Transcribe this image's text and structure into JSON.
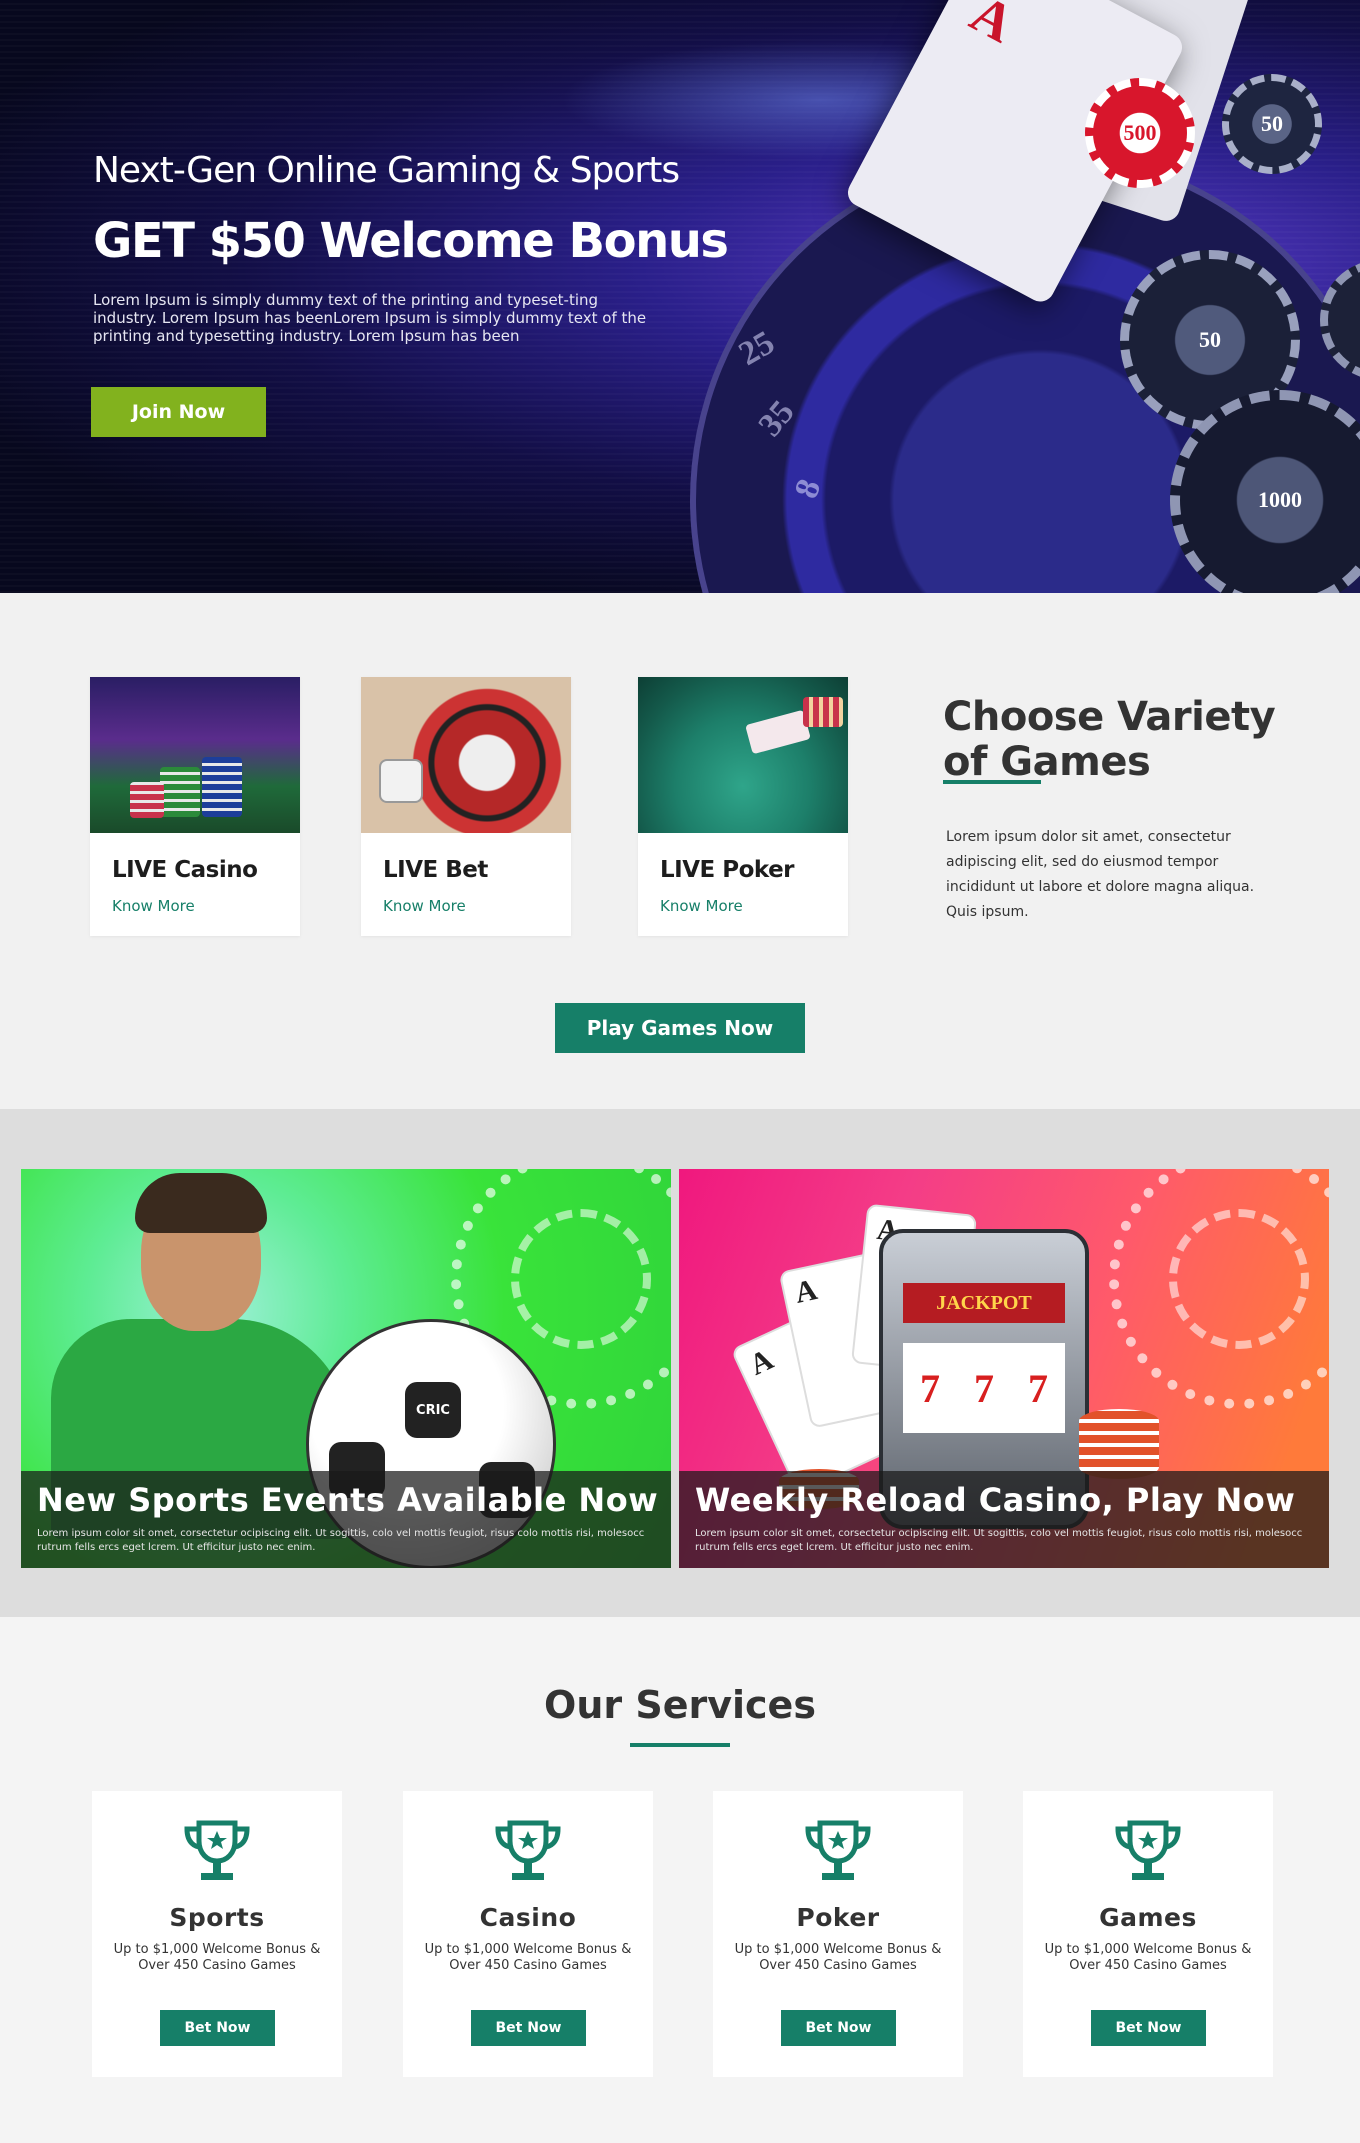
{
  "hero": {
    "subtitle": "Next-Gen Online Gaming & Sports",
    "title": "GET $50 Welcome Bonus",
    "description": "Lorem Ipsum is simply dummy text of the printing and typeset-ting industry. Lorem Ipsum has beenLorem Ipsum is simply dummy text of the printing and typesetting industry. Lorem Ipsum has been",
    "join_label": "Join Now",
    "chip_values": [
      "500",
      "50",
      "50",
      "1000"
    ],
    "ace": "A",
    "roulette_numbers": [
      "25",
      "35",
      "8"
    ]
  },
  "games": {
    "cards": [
      {
        "name": "LIVE Casino",
        "link": "Know More"
      },
      {
        "name": "LIVE Bet",
        "link": "Know More"
      },
      {
        "name": "LIVE Poker",
        "link": "Know More"
      }
    ],
    "heading": "Choose Variety of Games",
    "description": "Lorem ipsum dolor sit amet, consectetur adipiscing elit, sed do eiusmod tempor incididunt ut labore et dolore magna aliqua. Quis ipsum.",
    "play_label": "Play Games Now"
  },
  "promos": [
    {
      "title": "New Sports Events Available Now",
      "description": "Lorem ipsum color sit omet, corsectetur ocipiscing elit. Ut sogittis, colo vel mottis feugiot, risus colo mottis risi, molesocc rutrum fells ercs eget lcrem. Ut efficitur justo nec enim."
    },
    {
      "title": "Weekly Reload Casino, Play Now",
      "description": "Lorem ipsum color sit omet, corsectetur ocipiscing elit. Ut sogittis, colo vel mottis feugiot, risus colo mottis risi, molesocc rutrum fells ercs eget lcrem. Ut efficitur justo nec enim."
    }
  ],
  "promo_art": {
    "ball_brand": "CRIC",
    "jackpot": "JACKPOT",
    "reels": [
      "7",
      "7",
      "7"
    ],
    "card_ace": "A"
  },
  "services": {
    "title": "Our Services",
    "items": [
      {
        "name": "Sports",
        "description": "Up to $1,000 Welcome Bonus & Over 450 Casino Games",
        "button": "Bet Now"
      },
      {
        "name": "Casino",
        "description": "Up to $1,000 Welcome Bonus & Over 450 Casino Games",
        "button": "Bet Now"
      },
      {
        "name": "Poker",
        "description": "Up to $1,000 Welcome Bonus & Over 450 Casino Games",
        "button": "Bet Now"
      },
      {
        "name": "Games",
        "description": "Up to $1,000 Welcome Bonus & Over 450 Casino Games",
        "button": "Bet Now"
      }
    ]
  },
  "colors": {
    "accent": "#167f68",
    "join_button": "#82b21e",
    "hero_bg": "#120e45"
  },
  "icons": {
    "service_icon": "trophy-star-icon"
  }
}
